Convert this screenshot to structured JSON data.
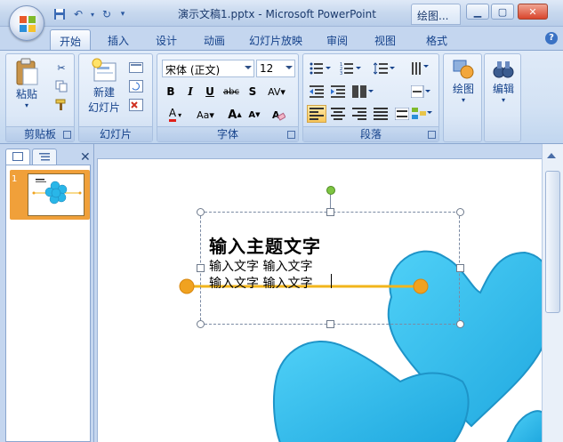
{
  "titlebar": {
    "title": "演示文稿1.pptx - Microsoft PowerPoint",
    "context_tab": "绘图...",
    "quick_access": [
      "save-icon",
      "undo-icon",
      "redo-icon",
      "customize-icon"
    ]
  },
  "tabs": [
    {
      "label": "开始",
      "active": true
    },
    {
      "label": "插入"
    },
    {
      "label": "设计"
    },
    {
      "label": "动画"
    },
    {
      "label": "幻灯片放映"
    },
    {
      "label": "审阅"
    },
    {
      "label": "视图"
    },
    {
      "label": "格式"
    }
  ],
  "ribbon": {
    "clipboard": {
      "label": "剪贴板",
      "paste": "粘贴"
    },
    "slides": {
      "label": "幻灯片",
      "new_slide_line1": "新建",
      "new_slide_line2": "幻灯片"
    },
    "font": {
      "label": "字体",
      "font_name": "宋体 (正文)",
      "font_size": "12"
    },
    "paragraph": {
      "label": "段落"
    },
    "drawing": {
      "label": "绘图"
    },
    "editing": {
      "label": "编辑"
    }
  },
  "left_panel": {
    "slide_number": "1"
  },
  "slide": {
    "title": "输入主题文字",
    "line1": "输入文字  输入文字",
    "line2": "输入文字  输入文字"
  },
  "colors": {
    "heart": "#29b6e8",
    "connector": "#f2b51b",
    "connector_dot": "#f0a220",
    "selection": "#f0a03a"
  }
}
